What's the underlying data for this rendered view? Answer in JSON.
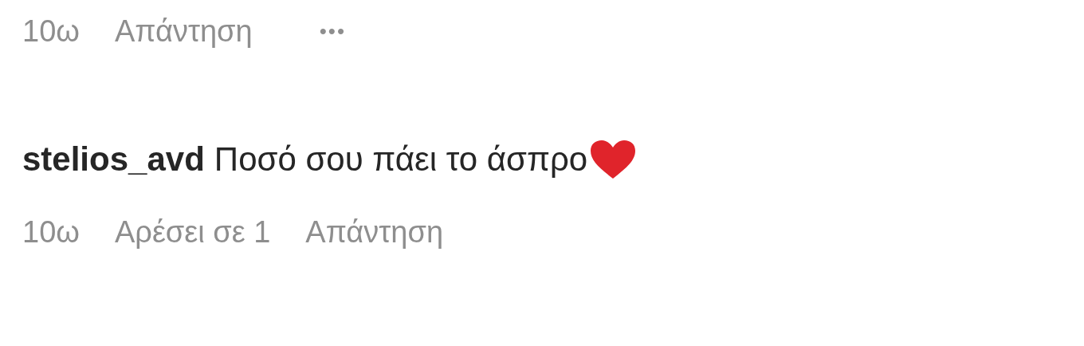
{
  "comments": [
    {
      "meta": {
        "time": "10ω",
        "reply": "Απάντηση",
        "more": "•••"
      }
    },
    {
      "username": "stelios_avd",
      "text": "Ποσό σου πάει το άσπρο",
      "heart": true,
      "meta": {
        "time": "10ω",
        "likes": "Αρέσει σε 1",
        "reply": "Απάντηση"
      }
    }
  ]
}
